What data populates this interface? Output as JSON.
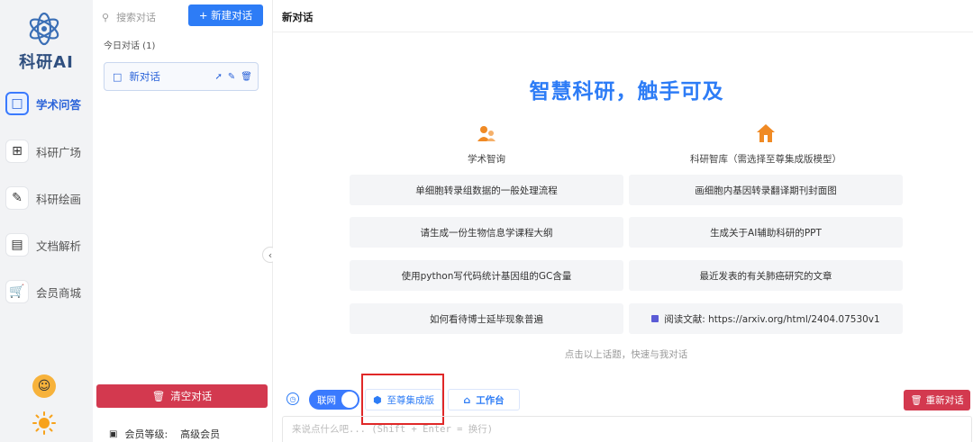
{
  "brand": {
    "name": "科研AI"
  },
  "nav": {
    "items": [
      {
        "label": "学术问答",
        "icon": "chat-bubble-icon",
        "active": true
      },
      {
        "label": "科研广场",
        "icon": "grid-icon",
        "active": false
      },
      {
        "label": "科研绘画",
        "icon": "paint-icon",
        "active": false
      },
      {
        "label": "文档解析",
        "icon": "document-icon",
        "active": false
      },
      {
        "label": "会员商城",
        "icon": "cart-icon",
        "active": false
      }
    ]
  },
  "sidebar": {
    "search_placeholder": "搜索对话",
    "new_chat_label": "+ 新建对话",
    "group_title": "今日对话 (1)",
    "conversation_title": "新对话",
    "clear_label": "清空对话",
    "member_label": "会员等级:",
    "member_value": "高级会员"
  },
  "header": {
    "title": "新对话"
  },
  "main": {
    "hero": "智慧科研，触手可及",
    "columns": [
      {
        "label": "学术智询",
        "icon": "people-icon",
        "color": "#f08a24"
      },
      {
        "label": "科研智库（需选择至尊集成版模型）",
        "icon": "home-icon",
        "color": "#f08a24"
      }
    ],
    "prompts_left": [
      "单细胞转录组数据的一般处理流程",
      "请生成一份生物信息学课程大纲",
      "使用python写代码统计基因组的GC含量",
      "如何看待博士延毕现象普遍"
    ],
    "prompts_right": [
      "画细胞内基因转录翻译期刊封面图",
      "生成关于AI辅助科研的PPT",
      "最近发表的有关肺癌研究的文章",
      "阅读文献: https://arxiv.org/html/2404.07530v1"
    ],
    "hint": "点击以上话题，快速与我对话"
  },
  "input": {
    "net_label": "联网",
    "model_label": "至尊集成版",
    "workspace_label": "工作台",
    "restart_label": "重新对话",
    "placeholder": "来说点什么吧... (Shift + Enter = 换行)"
  },
  "colors": {
    "accent": "#2d7cf6",
    "danger": "#d3394f",
    "highlight_box": "#e02828"
  }
}
